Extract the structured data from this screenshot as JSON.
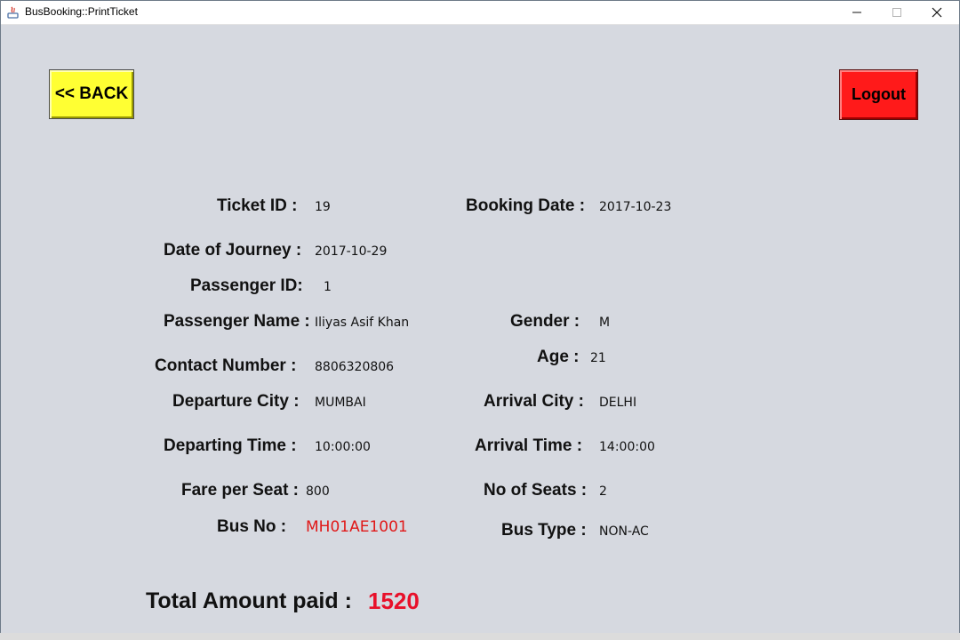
{
  "window": {
    "title": "BusBooking::PrintTicket"
  },
  "buttons": {
    "back": "<< BACK",
    "logout": "Logout"
  },
  "ticket": {
    "ticket_id_label": "Ticket ID :",
    "ticket_id": "19",
    "booking_date_label": "Booking Date :",
    "booking_date": "2017-10-23",
    "journey_date_label": "Date of Journey :",
    "journey_date": "2017-10-29",
    "passenger_id_label": "Passenger ID:",
    "passenger_id": "1",
    "passenger_name_label": "Passenger Name :",
    "passenger_name": "Iliyas Asif Khan",
    "gender_label": "Gender :",
    "gender": "M",
    "contact_label": "Contact Number :",
    "contact": "8806320806",
    "age_label": "Age :",
    "age": "21",
    "departure_city_label": "Departure City :",
    "departure_city": "MUMBAI",
    "arrival_city_label": "Arrival City :",
    "arrival_city": "DELHI",
    "departing_time_label": "Departing Time :",
    "departing_time": "10:00:00",
    "arrival_time_label": "Arrival Time :",
    "arrival_time": "14:00:00",
    "fare_label": "Fare per Seat :",
    "fare": "800",
    "seats_label": "No of Seats :",
    "seats": "2",
    "bus_no_label": "Bus No :",
    "bus_no": "MH01AE1001",
    "bus_type_label": "Bus Type :",
    "bus_type": "NON-AC"
  },
  "total": {
    "label": "Total Amount paid :",
    "value": "1520"
  },
  "colors": {
    "back_button": "#ffff33",
    "logout_button": "#ff1a1a",
    "highlight_red": "#e8102a",
    "window_bg": "#d6d9e0"
  }
}
